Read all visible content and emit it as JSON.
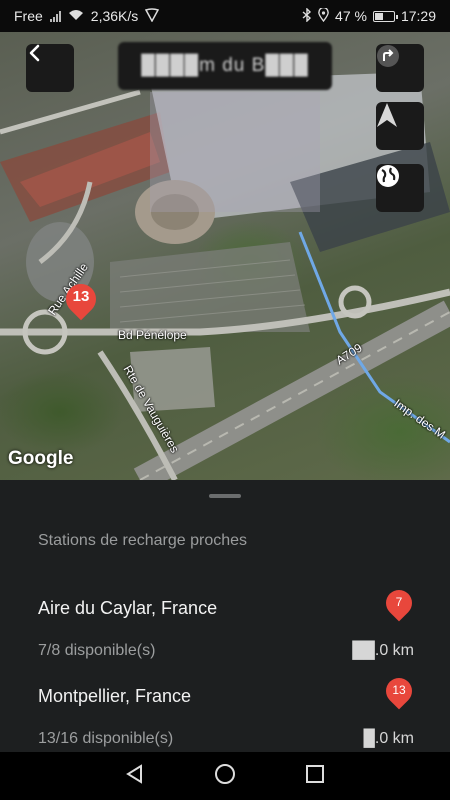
{
  "status_bar": {
    "carrier": "Free",
    "speed": "2,36K/s",
    "battery": "47 %",
    "battery_level": 0.47,
    "time": "17:29"
  },
  "map": {
    "search_text": "████m du B███",
    "labels": {
      "rue_achille": "Rue Achille",
      "bd_penelope": "Bd Pénélope",
      "rue_vaugueres": "Rte de Vauguières",
      "a709": "A709",
      "imp_des": "Imp. des M"
    },
    "pin_number": "13",
    "attribution": "Google"
  },
  "sheet": {
    "title": "Stations de recharge proches",
    "stations": [
      {
        "name": "Aire du Caylar, France",
        "availability": "7/8 disponible(s)",
        "distance": "██.0 km",
        "pin": "7"
      },
      {
        "name": "Montpellier, France",
        "availability": "13/16 disponible(s)",
        "distance": "█.0 km",
        "pin": "13"
      }
    ]
  },
  "icons": {
    "back": "chevron-left-icon",
    "route": "turn-arrow-icon",
    "navigate": "navigation-arrow-icon",
    "globe": "globe-icon"
  },
  "colors": {
    "pin": "#e8473c",
    "sheet_bg": "#1d1f20",
    "route_line": "#6fa8e6"
  }
}
